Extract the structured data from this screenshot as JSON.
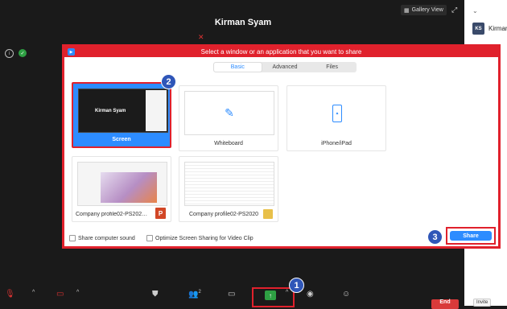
{
  "meeting": {
    "host_name": "Kirman Syam",
    "gallery_view_label": "Gallery View"
  },
  "participants": {
    "avatar_initials": "KS",
    "name": "Kirman",
    "invite_label": "Invite"
  },
  "toolbar": {
    "participants_count": "2",
    "end_label": "End"
  },
  "dialog": {
    "title": "Select a window or an application that you want to share",
    "tabs": [
      {
        "label": "Basic",
        "active": true
      },
      {
        "label": "Advanced",
        "active": false
      },
      {
        "label": "Files",
        "active": false
      }
    ],
    "items": {
      "screen": {
        "label": "Screen",
        "thumb_name": "Kirman Syam"
      },
      "whiteboard": {
        "label": "Whiteboard"
      },
      "iphone": {
        "label": "iPhone/iPad"
      },
      "powerpoint": {
        "label": "Company profile02-PS2020 - Po..."
      },
      "excel": {
        "label": "Company profile02-PS2020"
      }
    },
    "share_sound_label": "Share computer sound",
    "optimize_label": "Optimize Screen Sharing for Video Clip",
    "share_button_label": "Share"
  },
  "annotations": {
    "badge1": "1",
    "badge2": "2",
    "badge3": "3"
  },
  "colors": {
    "accent": "#2d8cff",
    "highlight": "#e0212c",
    "badge": "#2f56b8"
  }
}
